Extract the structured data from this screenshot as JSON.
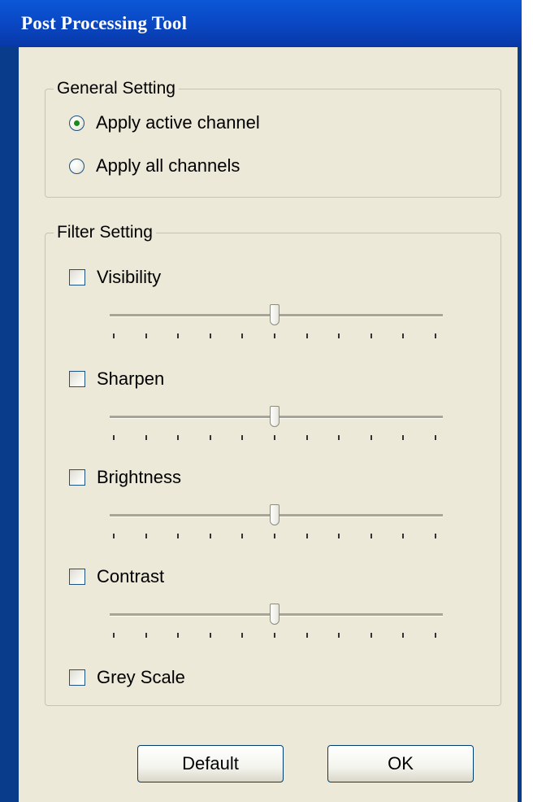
{
  "window": {
    "title": "Post Processing Tool"
  },
  "general": {
    "legend": "General Setting",
    "options": [
      {
        "label": "Apply active channel",
        "selected": true
      },
      {
        "label": "Apply all channels",
        "selected": false
      }
    ]
  },
  "filter": {
    "legend": "Filter Setting",
    "items": [
      {
        "label": "Visibility",
        "checked": false,
        "slider_level": 0.5
      },
      {
        "label": "Sharpen",
        "checked": false,
        "slider_level": 0.5
      },
      {
        "label": "Brightness",
        "checked": false,
        "slider_level": 0.5
      },
      {
        "label": "Contrast",
        "checked": false,
        "slider_level": 0.5
      },
      {
        "label": "Grey Scale",
        "checked": false
      }
    ]
  },
  "buttons": {
    "default_label": "Default",
    "ok_label": "OK"
  },
  "colors": {
    "titlebar": "#0a47c4",
    "dialog_bg": "#ece9d8",
    "radio_dot": "#1a8a1a"
  }
}
